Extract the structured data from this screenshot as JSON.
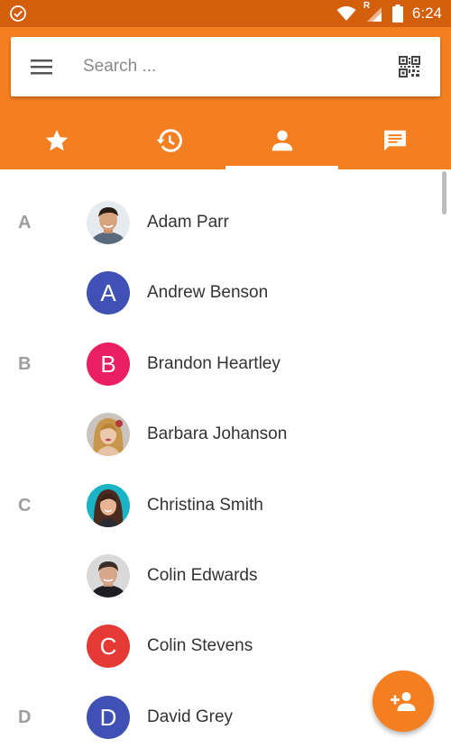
{
  "status_bar": {
    "time": "6:24",
    "icons": [
      "check-circle-icon",
      "wifi-icon",
      "signal-roaming-icon",
      "battery-icon"
    ],
    "roaming_label": "R"
  },
  "search": {
    "placeholder": "Search ...",
    "value": "",
    "menu_icon": "hamburger-menu-icon",
    "qr_icon": "qr-code-icon"
  },
  "tabs": [
    {
      "icon": "star-icon",
      "active": false
    },
    {
      "icon": "history-icon",
      "active": false
    },
    {
      "icon": "person-icon",
      "active": true
    },
    {
      "icon": "message-icon",
      "active": false
    }
  ],
  "contacts": [
    {
      "section": "A",
      "name": "Adam Parr",
      "avatar_type": "photo",
      "initial": ""
    },
    {
      "section": "",
      "name": "Andrew Benson",
      "avatar_type": "initial",
      "initial": "A",
      "color": "#3f51b5"
    },
    {
      "section": "B",
      "name": "Brandon Heartley",
      "avatar_type": "initial",
      "initial": "B",
      "color": "#e91e63"
    },
    {
      "section": "",
      "name": "Barbara Johanson",
      "avatar_type": "photo",
      "initial": ""
    },
    {
      "section": "C",
      "name": "Christina Smith",
      "avatar_type": "photo",
      "initial": ""
    },
    {
      "section": "",
      "name": "Colin Edwards",
      "avatar_type": "photo",
      "initial": ""
    },
    {
      "section": "",
      "name": "Colin Stevens",
      "avatar_type": "initial",
      "initial": "C",
      "color": "#e53935"
    },
    {
      "section": "D",
      "name": "David Grey",
      "avatar_type": "initial",
      "initial": "D",
      "color": "#3f51b5"
    }
  ],
  "fab": {
    "icon": "add-contact-icon"
  },
  "colors": {
    "primary": "#f47f21",
    "status_bar": "#d35f0c",
    "section_letter": "#9e9e9e",
    "contact_name": "#333333"
  }
}
